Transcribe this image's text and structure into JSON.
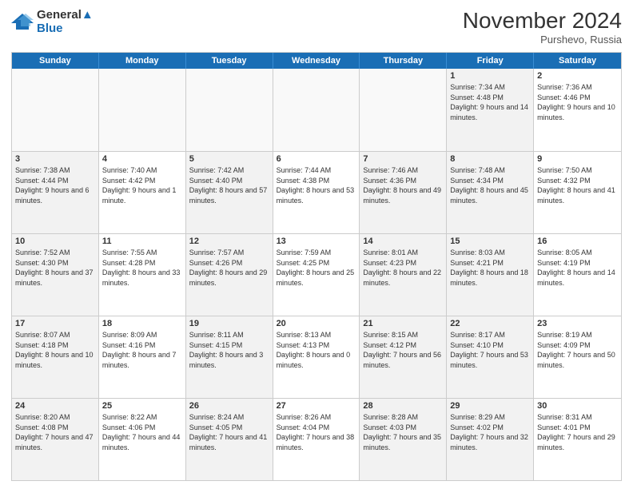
{
  "logo": {
    "line1": "General",
    "line2": "Blue"
  },
  "title": "November 2024",
  "location": "Purshevo, Russia",
  "days_of_week": [
    "Sunday",
    "Monday",
    "Tuesday",
    "Wednesday",
    "Thursday",
    "Friday",
    "Saturday"
  ],
  "weeks": [
    [
      {
        "day": "",
        "info": "",
        "empty": true
      },
      {
        "day": "",
        "info": "",
        "empty": true
      },
      {
        "day": "",
        "info": "",
        "empty": true
      },
      {
        "day": "",
        "info": "",
        "empty": true
      },
      {
        "day": "",
        "info": "",
        "empty": true
      },
      {
        "day": "1",
        "info": "Sunrise: 7:34 AM\nSunset: 4:48 PM\nDaylight: 9 hours and 14 minutes.",
        "shaded": true
      },
      {
        "day": "2",
        "info": "Sunrise: 7:36 AM\nSunset: 4:46 PM\nDaylight: 9 hours and 10 minutes."
      }
    ],
    [
      {
        "day": "3",
        "info": "Sunrise: 7:38 AM\nSunset: 4:44 PM\nDaylight: 9 hours and 6 minutes.",
        "shaded": true
      },
      {
        "day": "4",
        "info": "Sunrise: 7:40 AM\nSunset: 4:42 PM\nDaylight: 9 hours and 1 minute."
      },
      {
        "day": "5",
        "info": "Sunrise: 7:42 AM\nSunset: 4:40 PM\nDaylight: 8 hours and 57 minutes.",
        "shaded": true
      },
      {
        "day": "6",
        "info": "Sunrise: 7:44 AM\nSunset: 4:38 PM\nDaylight: 8 hours and 53 minutes."
      },
      {
        "day": "7",
        "info": "Sunrise: 7:46 AM\nSunset: 4:36 PM\nDaylight: 8 hours and 49 minutes.",
        "shaded": true
      },
      {
        "day": "8",
        "info": "Sunrise: 7:48 AM\nSunset: 4:34 PM\nDaylight: 8 hours and 45 minutes.",
        "shaded": true
      },
      {
        "day": "9",
        "info": "Sunrise: 7:50 AM\nSunset: 4:32 PM\nDaylight: 8 hours and 41 minutes."
      }
    ],
    [
      {
        "day": "10",
        "info": "Sunrise: 7:52 AM\nSunset: 4:30 PM\nDaylight: 8 hours and 37 minutes.",
        "shaded": true
      },
      {
        "day": "11",
        "info": "Sunrise: 7:55 AM\nSunset: 4:28 PM\nDaylight: 8 hours and 33 minutes."
      },
      {
        "day": "12",
        "info": "Sunrise: 7:57 AM\nSunset: 4:26 PM\nDaylight: 8 hours and 29 minutes.",
        "shaded": true
      },
      {
        "day": "13",
        "info": "Sunrise: 7:59 AM\nSunset: 4:25 PM\nDaylight: 8 hours and 25 minutes."
      },
      {
        "day": "14",
        "info": "Sunrise: 8:01 AM\nSunset: 4:23 PM\nDaylight: 8 hours and 22 minutes.",
        "shaded": true
      },
      {
        "day": "15",
        "info": "Sunrise: 8:03 AM\nSunset: 4:21 PM\nDaylight: 8 hours and 18 minutes.",
        "shaded": true
      },
      {
        "day": "16",
        "info": "Sunrise: 8:05 AM\nSunset: 4:19 PM\nDaylight: 8 hours and 14 minutes."
      }
    ],
    [
      {
        "day": "17",
        "info": "Sunrise: 8:07 AM\nSunset: 4:18 PM\nDaylight: 8 hours and 10 minutes.",
        "shaded": true
      },
      {
        "day": "18",
        "info": "Sunrise: 8:09 AM\nSunset: 4:16 PM\nDaylight: 8 hours and 7 minutes."
      },
      {
        "day": "19",
        "info": "Sunrise: 8:11 AM\nSunset: 4:15 PM\nDaylight: 8 hours and 3 minutes.",
        "shaded": true
      },
      {
        "day": "20",
        "info": "Sunrise: 8:13 AM\nSunset: 4:13 PM\nDaylight: 8 hours and 0 minutes."
      },
      {
        "day": "21",
        "info": "Sunrise: 8:15 AM\nSunset: 4:12 PM\nDaylight: 7 hours and 56 minutes.",
        "shaded": true
      },
      {
        "day": "22",
        "info": "Sunrise: 8:17 AM\nSunset: 4:10 PM\nDaylight: 7 hours and 53 minutes.",
        "shaded": true
      },
      {
        "day": "23",
        "info": "Sunrise: 8:19 AM\nSunset: 4:09 PM\nDaylight: 7 hours and 50 minutes."
      }
    ],
    [
      {
        "day": "24",
        "info": "Sunrise: 8:20 AM\nSunset: 4:08 PM\nDaylight: 7 hours and 47 minutes.",
        "shaded": true
      },
      {
        "day": "25",
        "info": "Sunrise: 8:22 AM\nSunset: 4:06 PM\nDaylight: 7 hours and 44 minutes."
      },
      {
        "day": "26",
        "info": "Sunrise: 8:24 AM\nSunset: 4:05 PM\nDaylight: 7 hours and 41 minutes.",
        "shaded": true
      },
      {
        "day": "27",
        "info": "Sunrise: 8:26 AM\nSunset: 4:04 PM\nDaylight: 7 hours and 38 minutes."
      },
      {
        "day": "28",
        "info": "Sunrise: 8:28 AM\nSunset: 4:03 PM\nDaylight: 7 hours and 35 minutes.",
        "shaded": true
      },
      {
        "day": "29",
        "info": "Sunrise: 8:29 AM\nSunset: 4:02 PM\nDaylight: 7 hours and 32 minutes.",
        "shaded": true
      },
      {
        "day": "30",
        "info": "Sunrise: 8:31 AM\nSunset: 4:01 PM\nDaylight: 7 hours and 29 minutes."
      }
    ]
  ]
}
